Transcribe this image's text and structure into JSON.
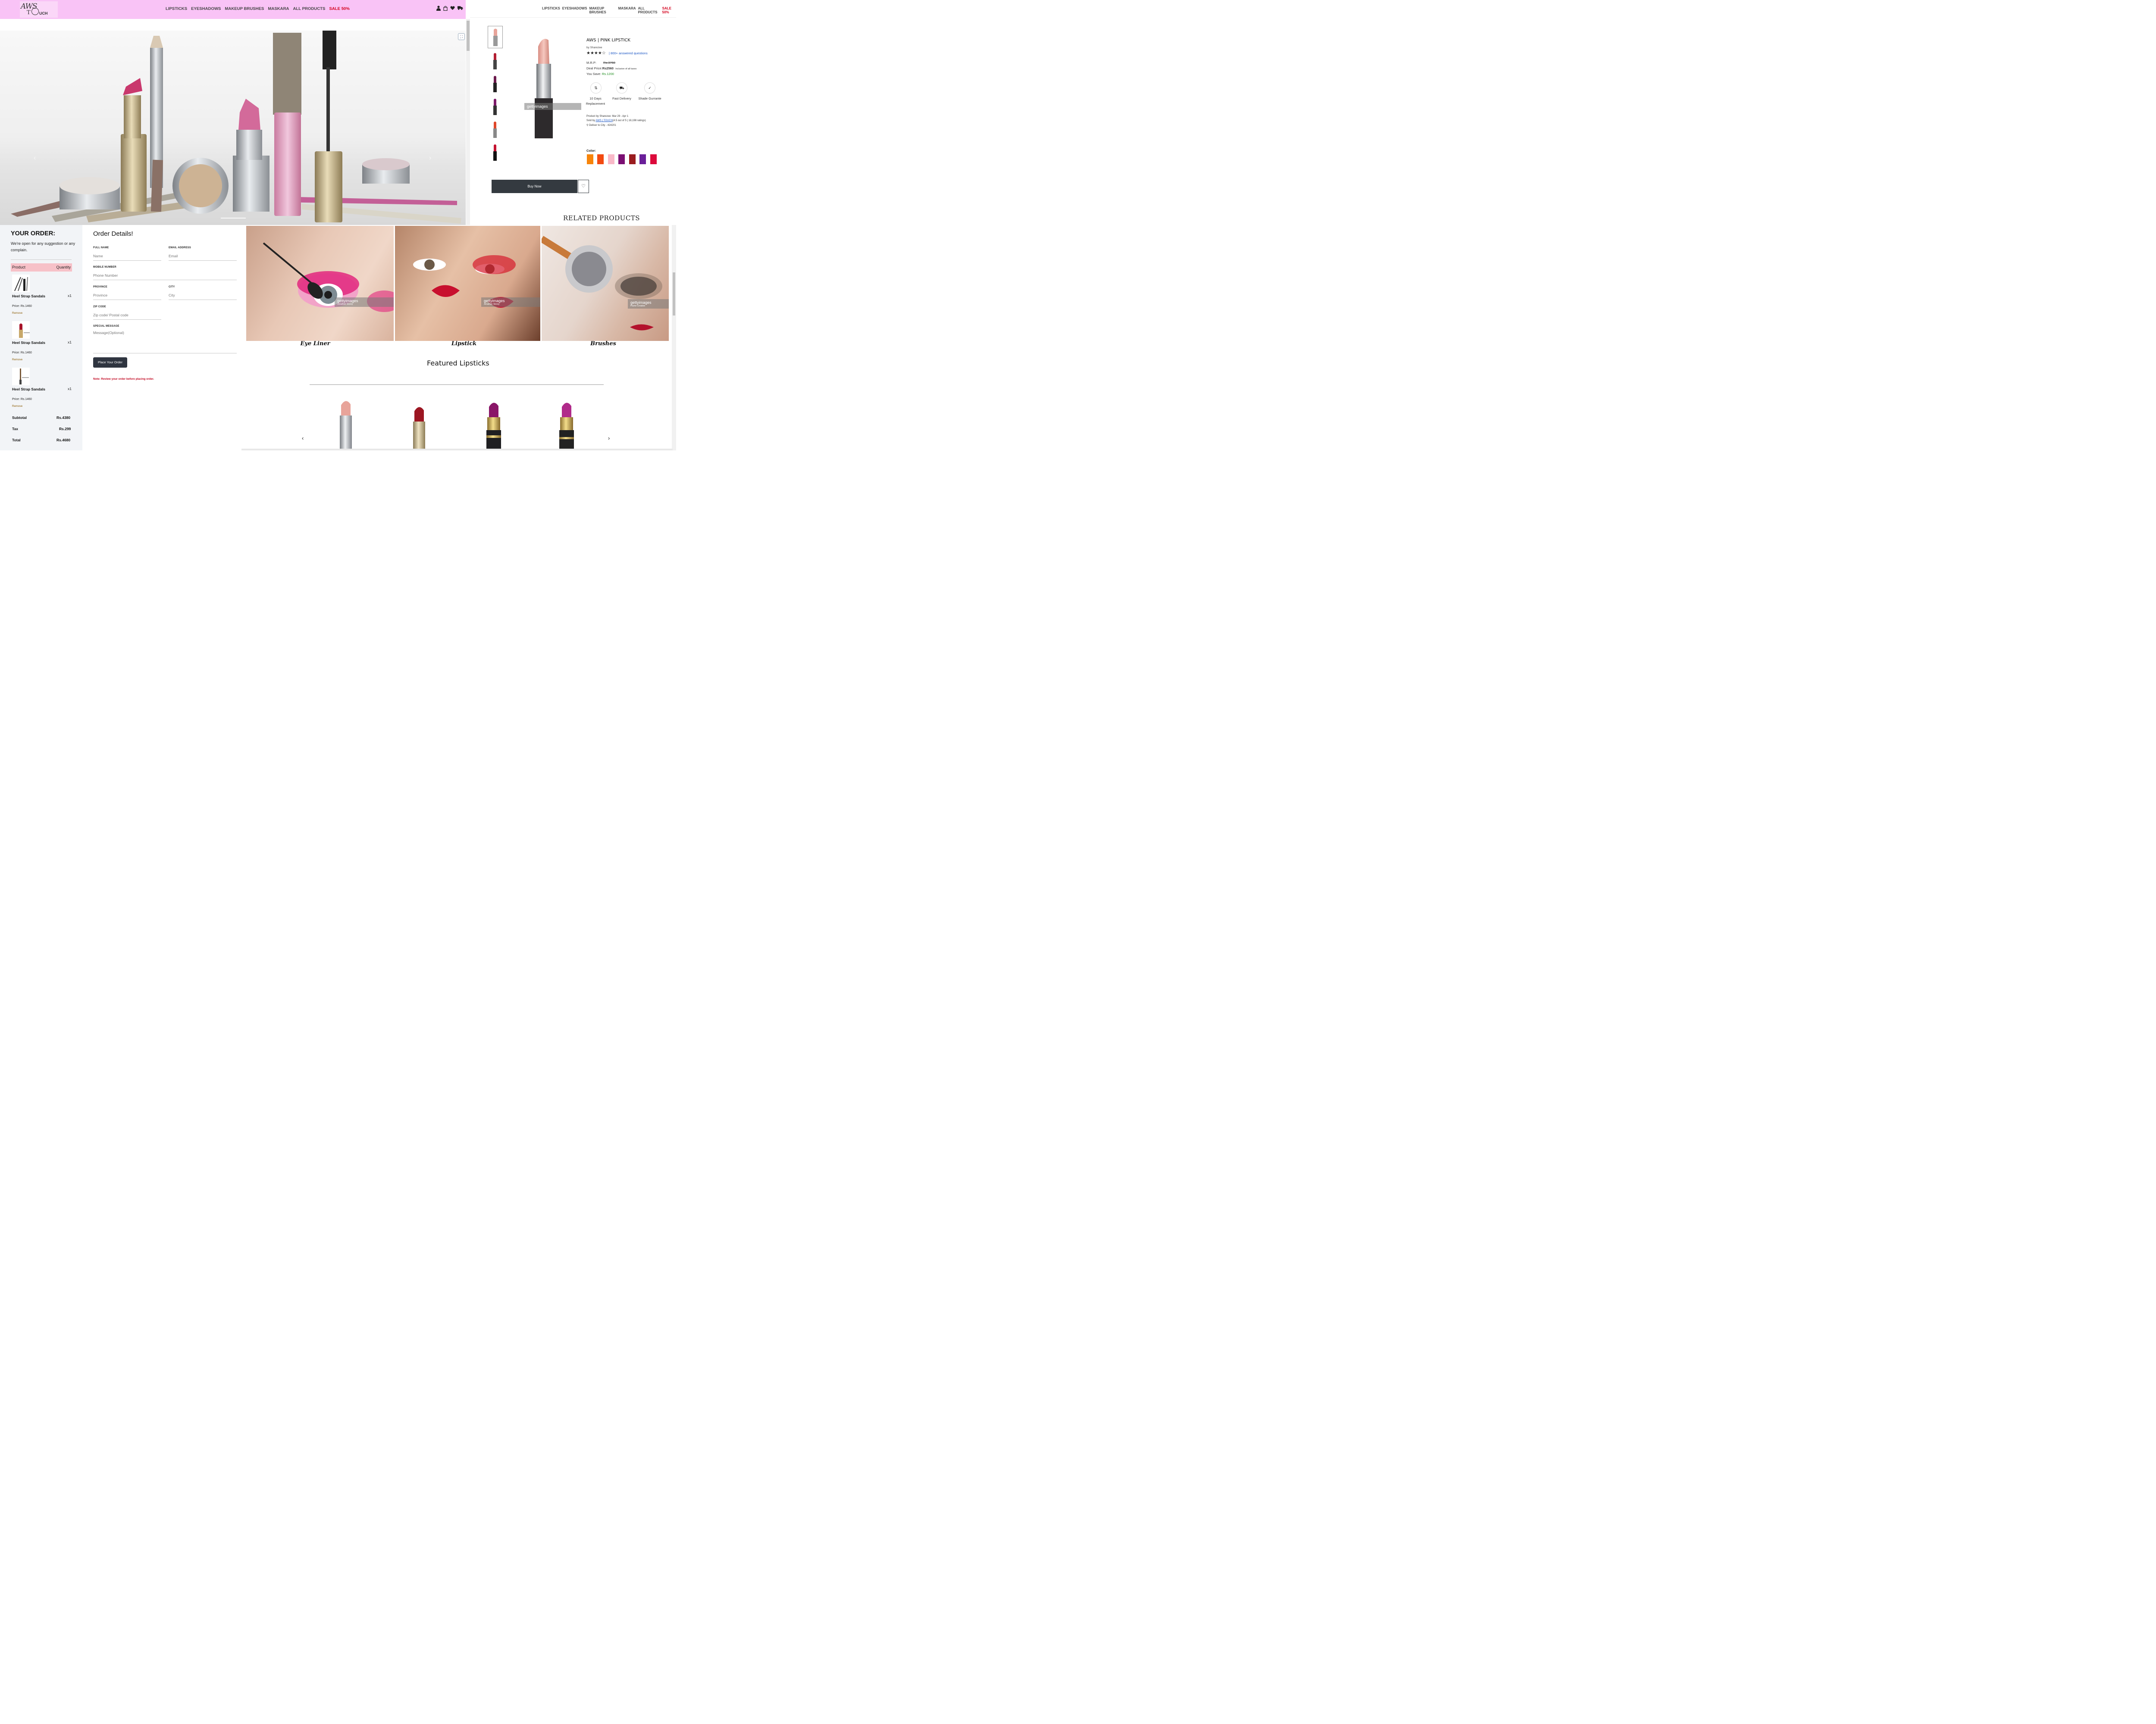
{
  "brand": {
    "line1": "AWS",
    "line2": "T",
    "line3": "UCH"
  },
  "nav": {
    "items": [
      "LIPSTICKS",
      "EYESHADOWS",
      "MAKEUP BRUSHES",
      "MASKARA",
      "ALL PRODUCTS"
    ],
    "sale": "Sale 50%"
  },
  "header_icons": [
    "user-icon",
    "shopping-bag-icon",
    "heart-icon",
    "truck-icon"
  ],
  "hero": {
    "prev": "‹",
    "next": "›"
  },
  "product": {
    "title": "AWS | PINK LIPSTICK",
    "by": "by Sharezee",
    "stars": "★★★★☆",
    "answered": "| 800+ answered questions",
    "mrp_label": "M.R.P:",
    "mrp_value": "Rs.3760",
    "deal_label": "Deal Price:",
    "deal_value": "Rs2560",
    "deal_note": "Inclusive of all taxes",
    "save_label": "You Save:",
    "save_value": "Rs.1200",
    "features": [
      {
        "icon": "replace-icon",
        "glyph": "⇅",
        "label": "10 Days Replacement"
      },
      {
        "icon": "truck-icon",
        "glyph": "⛟",
        "label": "Fast Delivery"
      },
      {
        "icon": "check-icon",
        "glyph": "✓",
        "label": "Shade Gurrante"
      }
    ],
    "info_line1": "Product by Sharezee: Mar 29 - Apr 1",
    "info_sold_prefix": "Sold by",
    "info_sold_link": "AWS | TOUCH",
    "info_sold_suffix": "(4.5 out of 5 | 18,198 ratings)",
    "info_deliver": "Deliver to City - 424201",
    "color_label": "Color:",
    "colors": [
      "#f7840a",
      "#f24a11",
      "#f9b9c8",
      "#7b0f73",
      "#9a1c1f",
      "#6a1f99",
      "#dc0a3b"
    ],
    "buy_label": "Buy Now",
    "wish_glyph": "♡",
    "related_title": "RELATED PRODUCTS"
  },
  "order": {
    "title": "YOUR ORDER:",
    "subtitle": "We're open for any suggestion or any complain.",
    "col_product": "Product",
    "col_quantity": "Quantity",
    "items": [
      {
        "name": "Heel Strap Sandals",
        "qty": "x1",
        "price": "Price: Rs.1460",
        "remove": "Remove"
      },
      {
        "name": "Heel Strap Sandals",
        "qty": "x1",
        "price": "Price: Rs.1460",
        "remove": "Remove"
      },
      {
        "name": "Heel Strap Sandals",
        "qty": "x1",
        "price": "Price: Rs.1460",
        "remove": "Remove"
      }
    ],
    "subtotal_label": "Subtotal",
    "subtotal_value": "Rs.4380",
    "tax_label": "Tax",
    "tax_value": "Rs.299",
    "total_label": "Total",
    "total_value": "Rs.4680"
  },
  "form": {
    "title": "Order Details!",
    "fullname_label": "FULL NAME",
    "fullname_placeholder": "Name",
    "email_label": "EMAIL ADDRESS",
    "email_placeholder": "Email",
    "mobile_label": "MOBILE NUMBER",
    "mobile_placeholder": "Phone Number",
    "province_label": "PROVINCE",
    "province_placeholder": "Province",
    "city_label": "CITY",
    "city_placeholder": "City",
    "zip_label": "ZIP CODE",
    "zip_placeholder": "Zip code/ Postal code",
    "message_label": "SPECIAL MESSAGE",
    "message_placeholder": "Message(Optional)",
    "submit_label": "Place Your Order",
    "note": "Note: Review your order before placing order."
  },
  "categories": [
    {
      "label": "Eye Liner",
      "watermark": "gettyimages",
      "credit": "Jonathan Storey"
    },
    {
      "label": "Lipstick",
      "watermark": "gettyimages",
      "credit": "Jonathan Storey"
    },
    {
      "label": "Brushes",
      "watermark": "gettyimages",
      "credit": "Plume Creative"
    }
  ],
  "featured": {
    "title": "Featured Lipsticks",
    "prev": "‹",
    "next": "›",
    "tips": [
      "#e8a49a",
      "#9c1622",
      "#8a1668",
      "#b02a8a"
    ]
  }
}
